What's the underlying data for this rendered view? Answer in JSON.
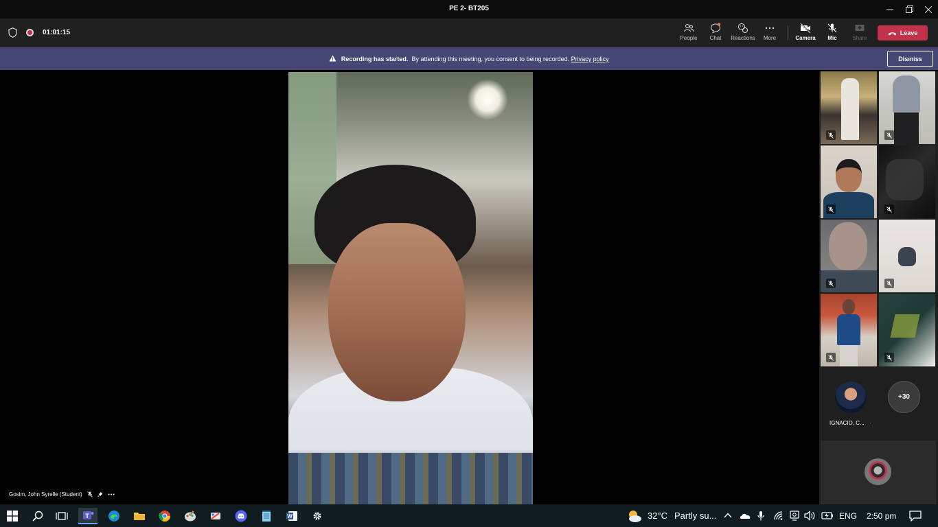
{
  "window": {
    "title": "PE 2- BT205"
  },
  "toolbar": {
    "timer": "01:01:15",
    "people_label": "People",
    "chat_label": "Chat",
    "reactions_label": "Reactions",
    "more_label": "More",
    "camera_label": "Camera",
    "mic_label": "Mic",
    "share_label": "Share",
    "leave_label": "Leave"
  },
  "banner": {
    "title": "Recording has started.",
    "message": "By attending this meeting, you consent to being recorded.",
    "link": "Privacy policy",
    "dismiss_label": "Dismiss"
  },
  "main": {
    "speaker_name": "Gosim, John Syrelle (Student)"
  },
  "sidebar": {
    "avatar_name": "IGNACIO, C...",
    "overflow_count": "+30"
  },
  "taskbar": {
    "weather_temp": "32°C",
    "weather_desc": "Partly su...",
    "language": "ENG",
    "time": "2:50 pm"
  },
  "colors": {
    "banner_bg": "#464775",
    "leave_bg": "#c4314b",
    "toolbar_bg": "#202020",
    "taskbar_bg": "#101c20"
  }
}
